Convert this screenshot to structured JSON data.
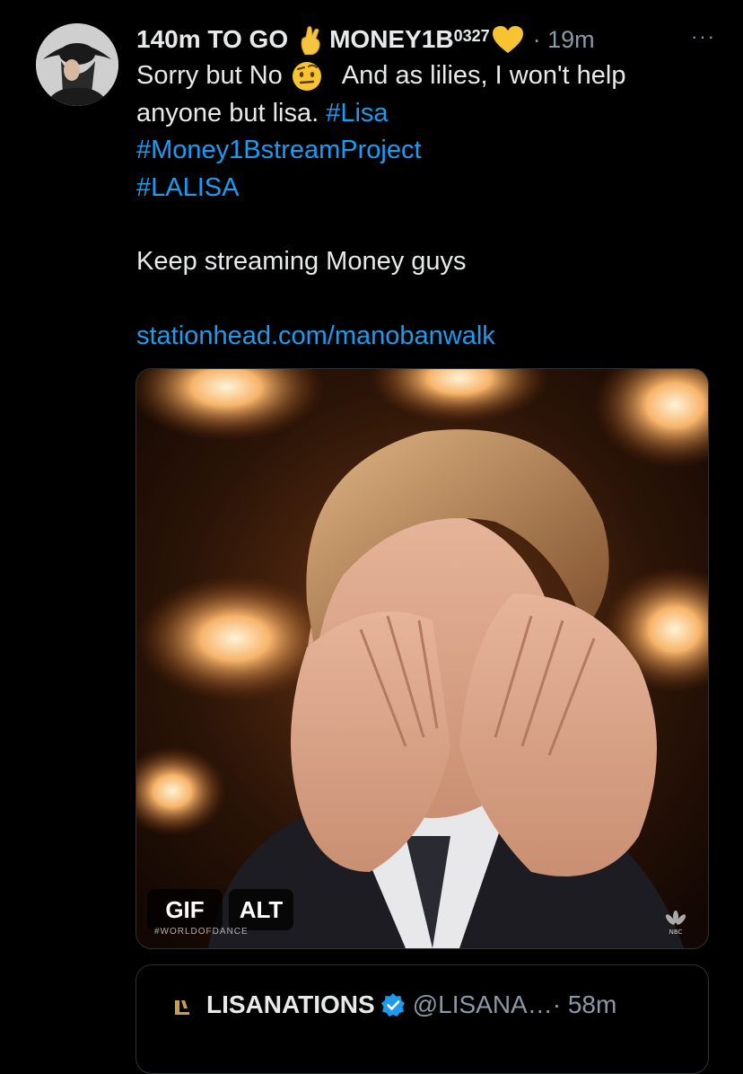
{
  "tweet": {
    "display_name": "140m TO GO",
    "name_suffix": "MONEY1B",
    "name_superscript": "0327",
    "time": "· 19m",
    "more": "···",
    "lines": [
      "Sorry but No",
      "And as lilies, I won't help",
      "anyone but lisa. ",
      "#Lisa",
      "#Money1BstreamProject",
      "#LALISA",
      "Keep streaming Money guys",
      "stationhead.com/manobanwalk"
    ]
  },
  "media": {
    "gif_label": "GIF",
    "alt_label": "ALT",
    "watermark": "#WORLDOFDANCE",
    "network": "NBC"
  },
  "quote": {
    "display_name": "LISANATIONS",
    "handle": "@LISANA…",
    "time": "· 58m"
  },
  "colors": {
    "background": "#000000",
    "text": "#e7e9ea",
    "secondary": "#8b98a5",
    "link": "#1d9bf0",
    "verified": "#1d9bf0"
  },
  "icons": {
    "crossed_fingers": "crossed-fingers-emoji",
    "heart": "yellow-heart-emoji",
    "face": "raised-eyebrow-emoji",
    "verified": "verified-badge-icon"
  }
}
